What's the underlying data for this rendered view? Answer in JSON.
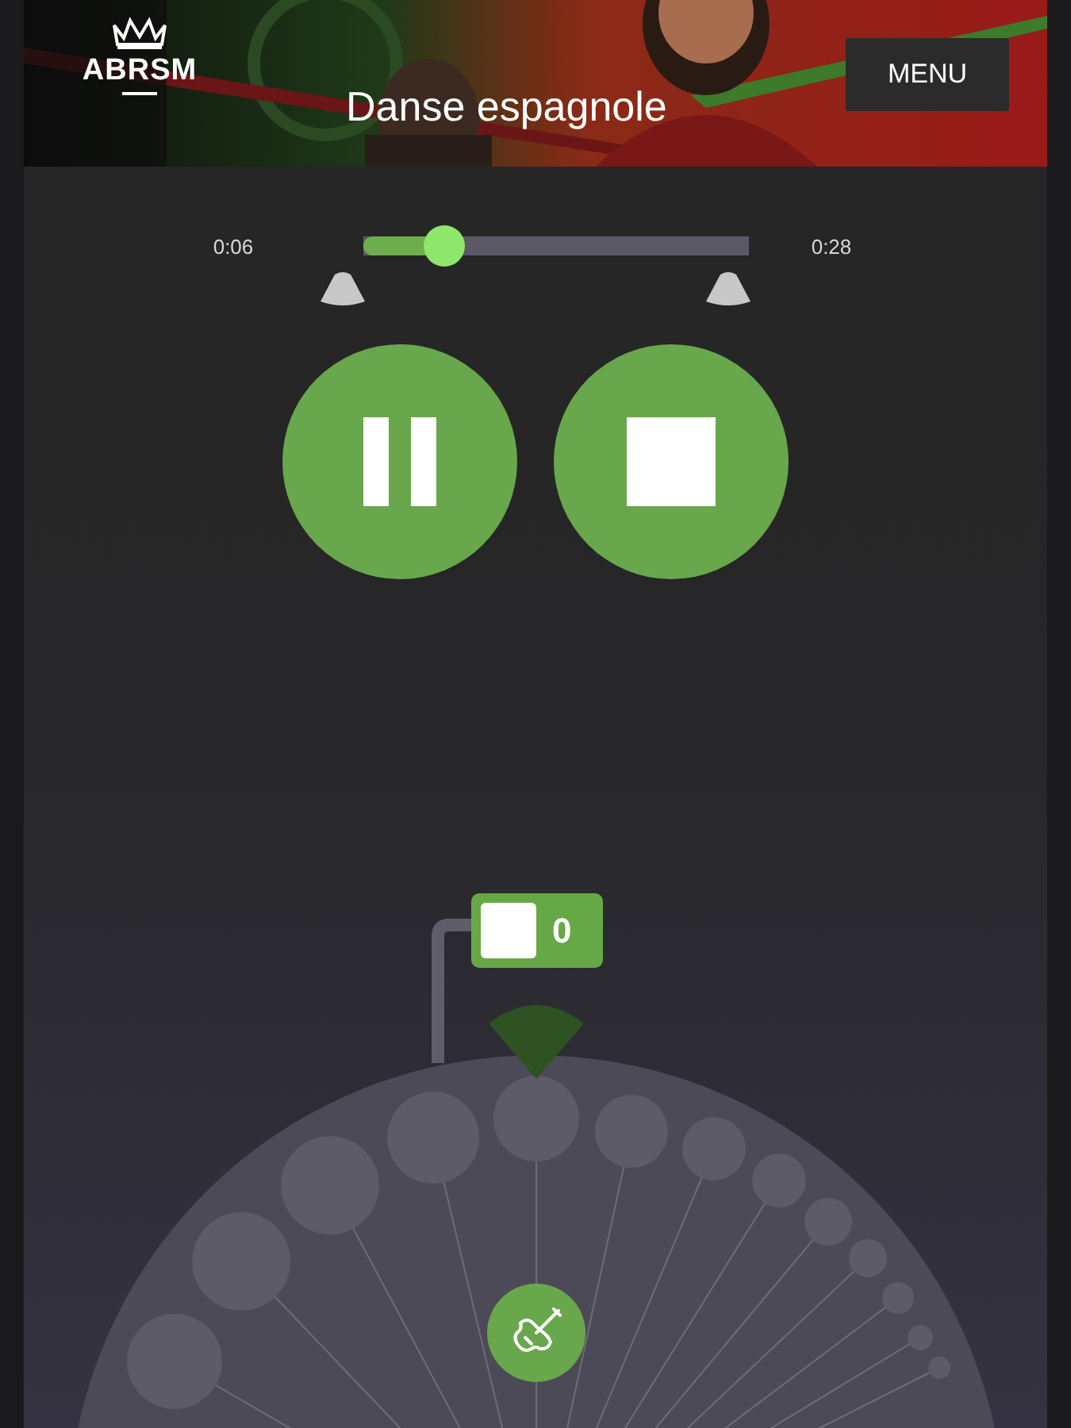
{
  "header": {
    "logo": "ABRSM",
    "title": "Danse espagnole",
    "menu": "MENU"
  },
  "player": {
    "elapsed": "0:06",
    "total": "0:28",
    "level": 0.21,
    "playing": true
  },
  "counter": {
    "value": "0"
  }
}
